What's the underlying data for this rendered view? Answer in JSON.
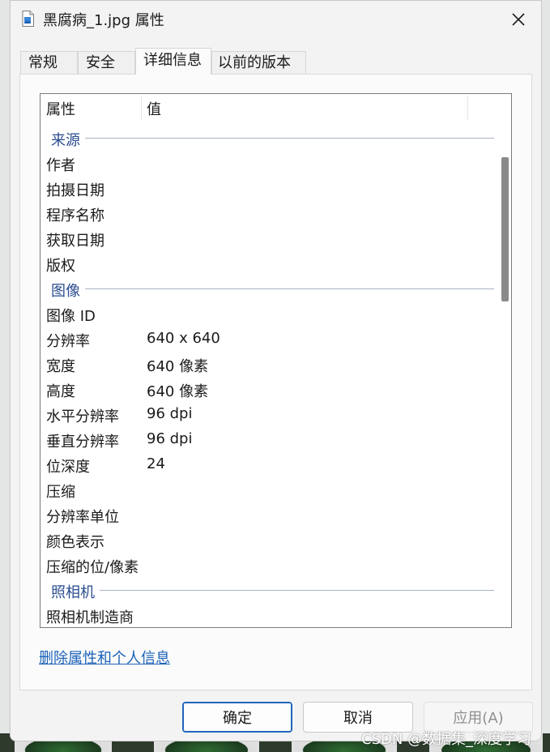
{
  "window": {
    "title": "黑腐病_1.jpg 属性",
    "file_icon": "image-file-icon",
    "close_icon": "close-icon"
  },
  "tabs": [
    {
      "label": "常规",
      "active": false
    },
    {
      "label": "安全",
      "active": false
    },
    {
      "label": "详细信息",
      "active": true
    },
    {
      "label": "以前的版本",
      "active": false
    }
  ],
  "details": {
    "columns": {
      "property": "属性",
      "value": "值"
    },
    "groups": [
      {
        "title": "来源",
        "rows": [
          {
            "name": "作者",
            "value": ""
          },
          {
            "name": "拍摄日期",
            "value": ""
          },
          {
            "name": "程序名称",
            "value": ""
          },
          {
            "name": "获取日期",
            "value": ""
          },
          {
            "name": "版权",
            "value": ""
          }
        ]
      },
      {
        "title": "图像",
        "rows": [
          {
            "name": "图像 ID",
            "value": ""
          },
          {
            "name": "分辨率",
            "value": "640 x 640"
          },
          {
            "name": "宽度",
            "value": "640 像素"
          },
          {
            "name": "高度",
            "value": "640 像素"
          },
          {
            "name": "水平分辨率",
            "value": "96 dpi"
          },
          {
            "name": "垂直分辨率",
            "value": "96 dpi"
          },
          {
            "name": "位深度",
            "value": "24"
          },
          {
            "name": "压缩",
            "value": ""
          },
          {
            "name": "分辨率单位",
            "value": ""
          },
          {
            "name": "颜色表示",
            "value": ""
          },
          {
            "name": "压缩的位/像素",
            "value": ""
          }
        ]
      },
      {
        "title": "照相机",
        "rows": [
          {
            "name": "照相机制造商",
            "value": ""
          }
        ]
      }
    ]
  },
  "remove_link": "删除属性和个人信息",
  "buttons": {
    "ok": "确定",
    "cancel": "取消",
    "apply": "应用(A)"
  },
  "watermark": "CSDN @数据集_深度学习",
  "colors": {
    "accent": "#2264bd",
    "link": "#1b62b8",
    "group_title": "#2a4d8f"
  }
}
